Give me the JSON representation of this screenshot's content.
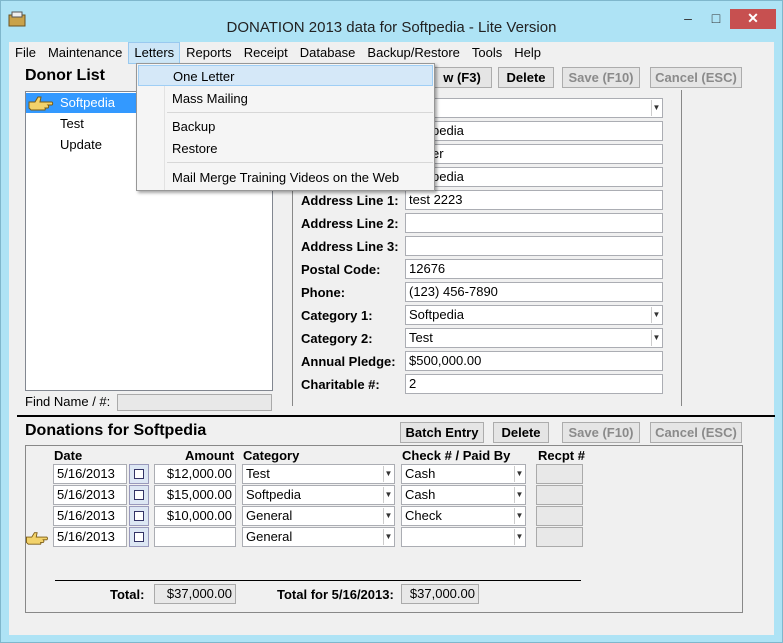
{
  "window": {
    "title": "DONATION 2013 data for Softpedia - Lite Version",
    "minimize": "–",
    "maximize": "□",
    "close": "✕"
  },
  "menubar": [
    "File",
    "Maintenance",
    "Letters",
    "Reports",
    "Receipt",
    "Database",
    "Backup/Restore",
    "Tools",
    "Help"
  ],
  "letters_menu": {
    "items": [
      "One Letter",
      "Mass Mailing",
      "Backup",
      "Restore",
      "Mail Merge Training Videos on the Web"
    ]
  },
  "donor_list": {
    "heading": "Donor List",
    "items": [
      "Softpedia",
      "Test",
      "Update"
    ],
    "find_label": "Find Name / #:",
    "find_value": ""
  },
  "donor_buttons": {
    "new": "w (F3)",
    "delete": "Delete",
    "save": "Save (F10)",
    "cancel": "Cancel (ESC)"
  },
  "donor_form": {
    "partial_values": [
      "",
      "pedia",
      "er",
      "pedia"
    ],
    "fields": [
      {
        "label": "Address Line 1:",
        "value": "test 2223"
      },
      {
        "label": "Address Line 2:",
        "value": ""
      },
      {
        "label": "Address Line 3:",
        "value": ""
      },
      {
        "label": "Postal Code:",
        "value": "12676"
      },
      {
        "label": "Phone:",
        "value": "(123) 456-7890"
      },
      {
        "label": "Category 1:",
        "value": "Softpedia"
      },
      {
        "label": "Category 2:",
        "value": "Test"
      },
      {
        "label": "Annual Pledge:",
        "value": "$500,000.00"
      },
      {
        "label": "Charitable #:",
        "value": "2"
      }
    ]
  },
  "donations": {
    "heading": "Donations for Softpedia",
    "buttons": {
      "batch": "Batch Entry",
      "delete": "Delete",
      "save": "Save (F10)",
      "cancel": "Cancel (ESC)"
    },
    "columns": [
      "Date",
      "Amount",
      "Category",
      "Check # / Paid By",
      "Recpt #"
    ],
    "rows": [
      {
        "date": "5/16/2013",
        "amount": "$12,000.00",
        "category": "Test",
        "paid": "Cash",
        "recpt": ""
      },
      {
        "date": "5/16/2013",
        "amount": "$15,000.00",
        "category": "Softpedia",
        "paid": "Cash",
        "recpt": ""
      },
      {
        "date": "5/16/2013",
        "amount": "$10,000.00",
        "category": "General",
        "paid": "Check",
        "recpt": ""
      },
      {
        "date": "5/16/2013",
        "amount": "",
        "category": "General",
        "paid": "",
        "recpt": ""
      }
    ],
    "total_label": "Total:",
    "total_value": "$37,000.00",
    "total_date_label": "Total for 5/16/2013:",
    "total_date_value": "$37,000.00"
  },
  "icons": {
    "app": "app-icon",
    "pointer": "pointing-hand-icon",
    "calendar": "calendar-icon",
    "dropdown": "chevron-down-icon"
  }
}
